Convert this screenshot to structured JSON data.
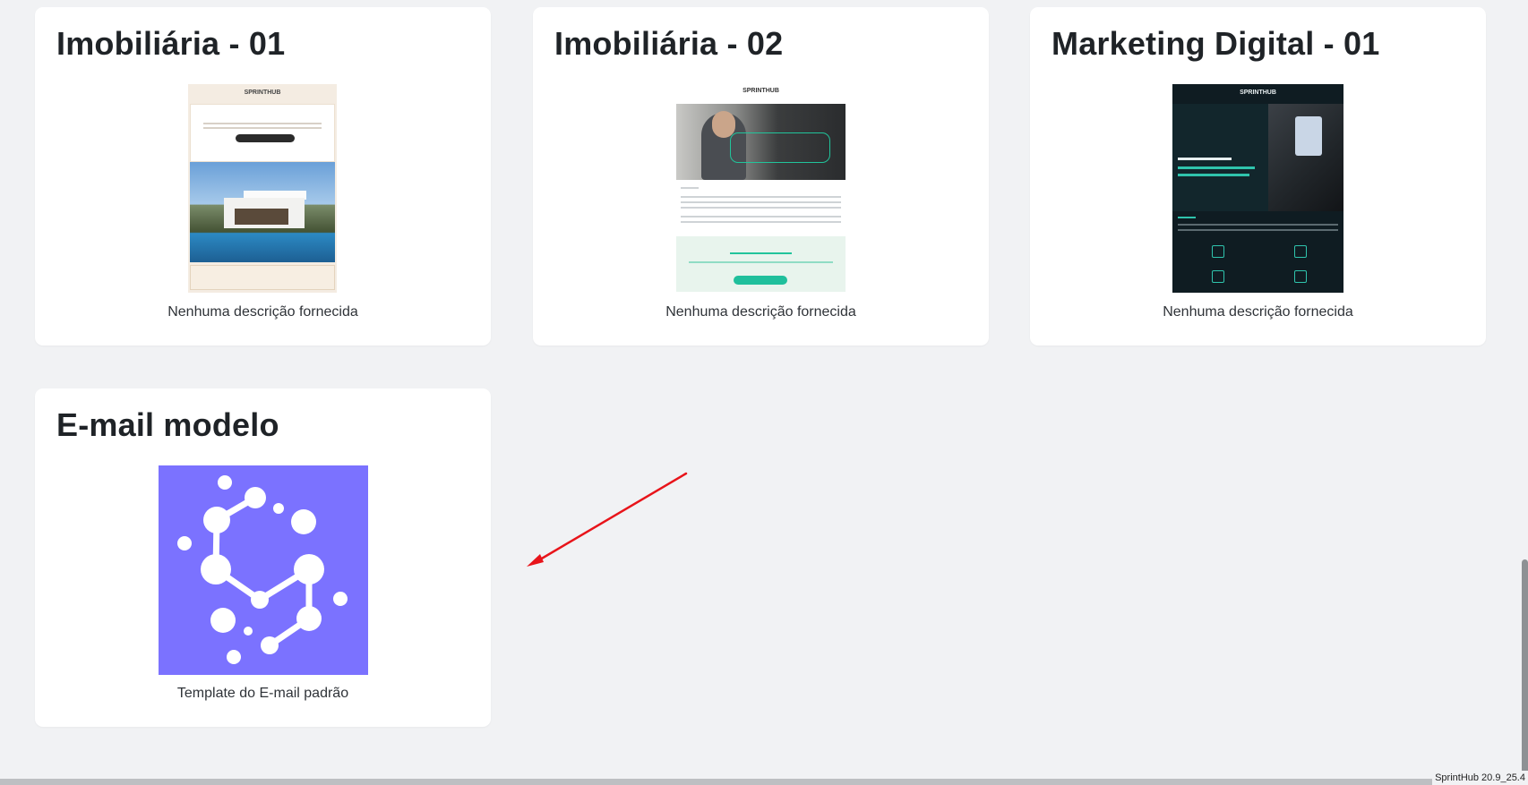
{
  "cards": [
    {
      "title": "Imobiliária - 01",
      "description": "Nenhuma descrição fornecida",
      "thumb_logo": "SPRINTHUB"
    },
    {
      "title": "Imobiliária - 02",
      "description": "Nenhuma descrição fornecida",
      "thumb_logo": "SPRINTHUB"
    },
    {
      "title": "Marketing Digital - 01",
      "description": "Nenhuma descrição fornecida",
      "thumb_logo": "SPRINTHUB"
    },
    {
      "title": "E-mail modelo",
      "description": "Template do E-mail padrão"
    }
  ],
  "footer": {
    "version": "SprintHub 20.9_25.4"
  },
  "colors": {
    "background": "#f1f2f4",
    "card": "#ffffff",
    "email_template_bg": "#7b72ff",
    "arrow": "#e8141a"
  }
}
